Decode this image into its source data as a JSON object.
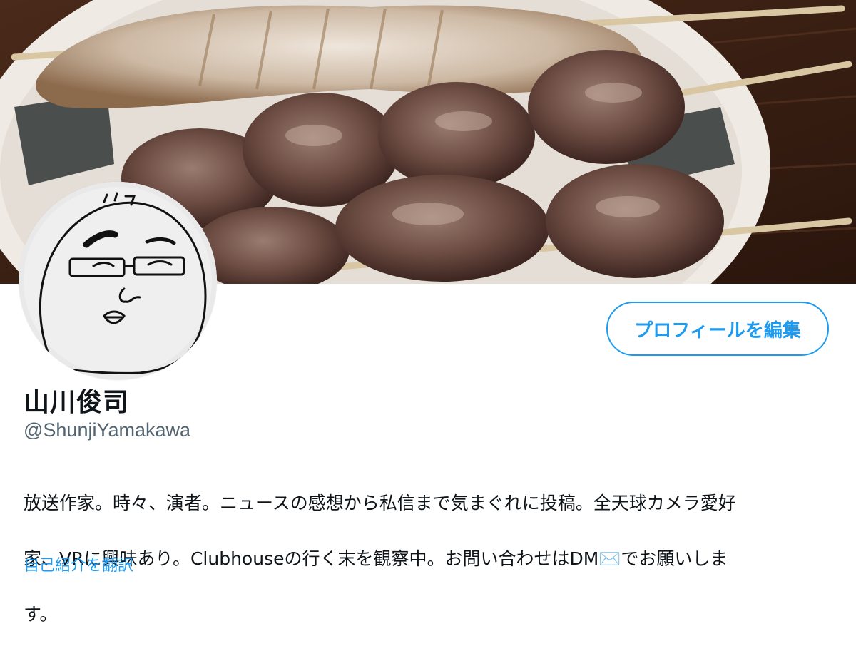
{
  "profile": {
    "banner_image": "grilled-yakitori-skewers-photo",
    "avatar_image": "hand-drawn-face-with-glasses",
    "edit_button_label": "プロフィールを編集",
    "display_name": "山川俊司",
    "handle": "@ShunjiYamakawa",
    "bio_lines": [
      "放送作家。時々、演者。ニュースの感想から私信まで気まぐれに投稿。全天球カメラ愛好",
      "家、VRに興味あり。Clubhouseの行く末を観察中。お問い合わせはDM✉️でお願いしま",
      "す。"
    ],
    "translate_link": "自己紹介を翻訳"
  },
  "colors": {
    "accent": "#1d9bf0",
    "text_primary": "#0f1419",
    "text_secondary": "#536471"
  }
}
